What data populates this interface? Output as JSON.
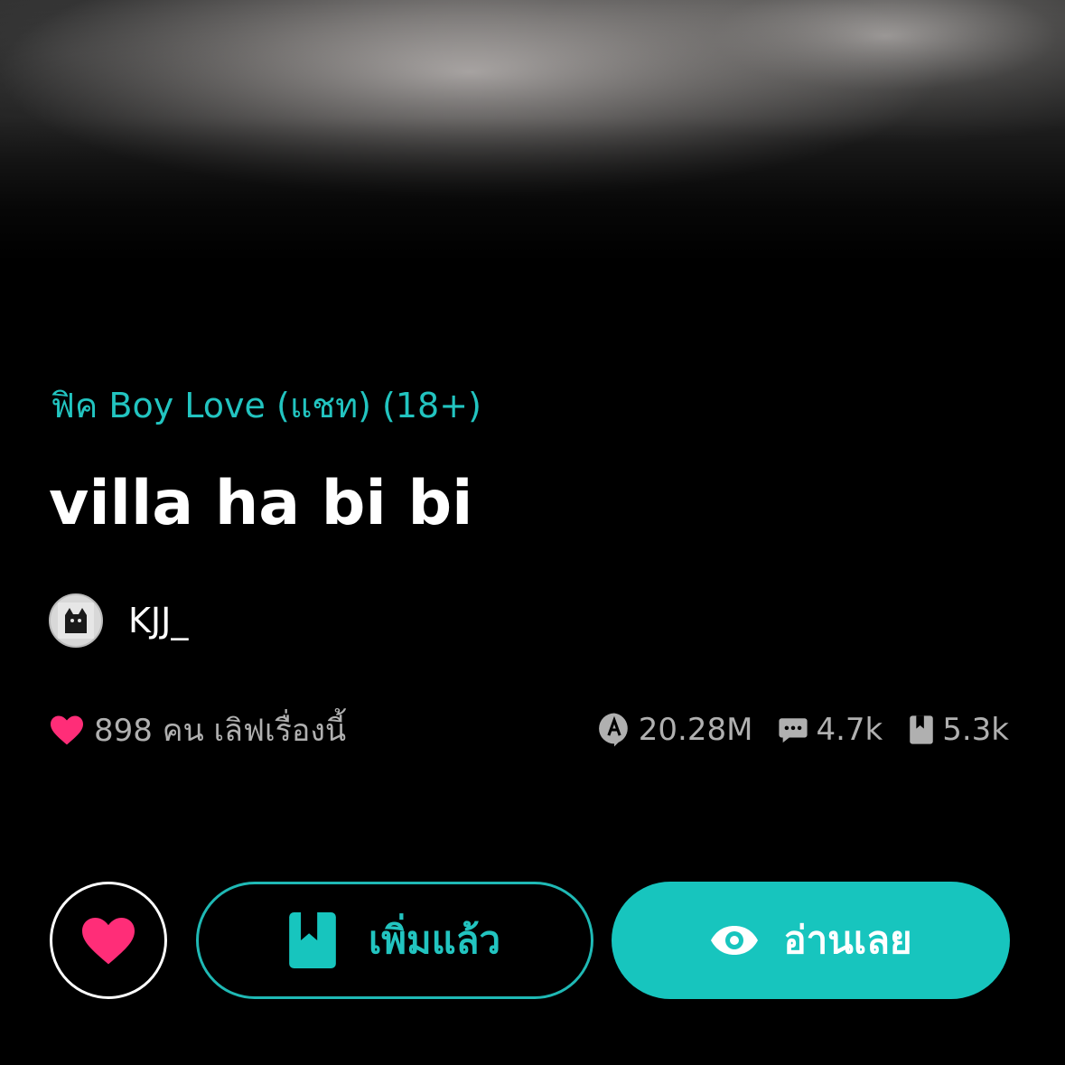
{
  "story": {
    "category": "ฟิค Boy Love (แชท) (18+)",
    "title": "villa ha bi bi",
    "author": "KJJ_"
  },
  "stats": {
    "love_text": "898 คน เลิฟเรื่องนี้",
    "views": "20.28M",
    "comments": "4.7k",
    "bookmarks": "5.3k"
  },
  "actions": {
    "added_label": "เพิ่มแล้ว",
    "read_label": "อ่านเลย"
  },
  "colors": {
    "accent": "#17c5be",
    "heart": "#ff2d78",
    "background": "#000000"
  },
  "icons": [
    "heart-icon",
    "views-icon",
    "comment-icon",
    "bookmark-icon",
    "book-icon",
    "eye-icon"
  ]
}
